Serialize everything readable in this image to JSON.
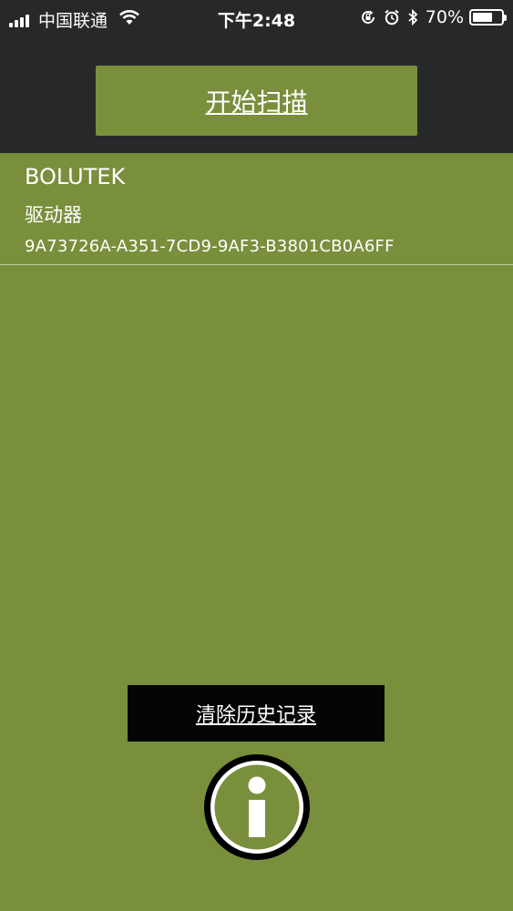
{
  "status_bar": {
    "carrier": "中国联通",
    "time": "下午2:48",
    "battery_percent": "70%",
    "battery_level": 0.7,
    "icons": [
      "signal-icon",
      "wifi-icon",
      "rotation-lock-icon",
      "alarm-icon",
      "bluetooth-icon",
      "battery-icon"
    ]
  },
  "header": {
    "scan_button_label": "开始扫描"
  },
  "device_list": [
    {
      "name": "BOLUTEK",
      "type": "驱动器",
      "uuid": "9A73726A-A351-7CD9-9AF3-B3801CB0A6FF"
    }
  ],
  "footer": {
    "clear_history_label": "清除历史记录",
    "info_icon": "info-icon"
  },
  "colors": {
    "header_bg": "#27282a",
    "accent_green": "#798f3c",
    "clear_button_bg": "#050505",
    "text": "#ffffff"
  }
}
